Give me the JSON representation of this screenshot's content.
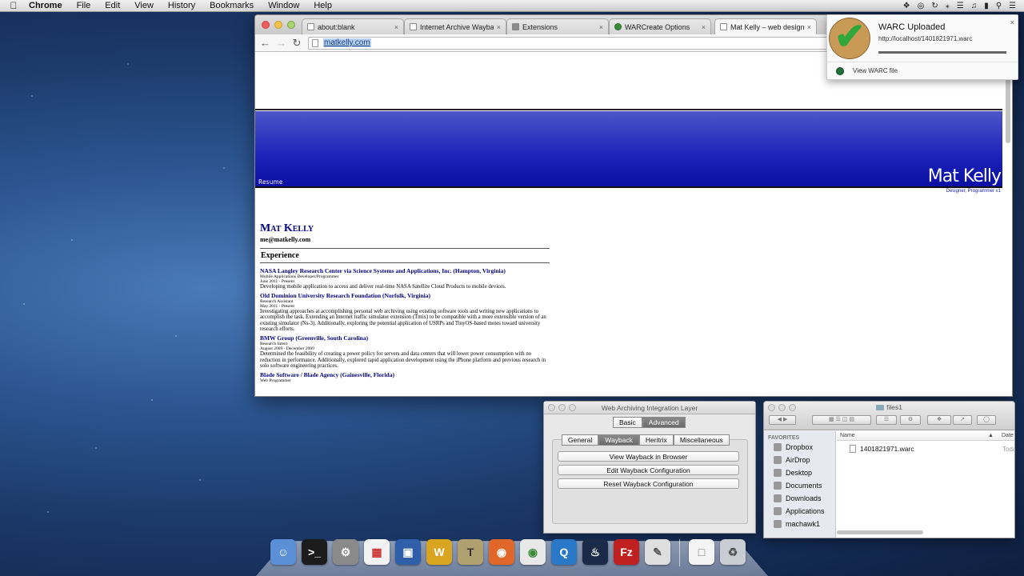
{
  "menubar": {
    "app": "Chrome",
    "items": [
      "File",
      "Edit",
      "View",
      "History",
      "Bookmarks",
      "Window",
      "Help"
    ],
    "status_icons": [
      "apple-icon",
      "dropbox-icon",
      "vpn-icon",
      "sync-icon",
      "bluetooth-icon",
      "wifi-icon",
      "volume-icon",
      "battery-icon",
      "search-icon",
      "list-icon"
    ]
  },
  "browser": {
    "tabs": [
      {
        "label": "about:blank",
        "icon": "page-icon",
        "close": "×"
      },
      {
        "label": "Internet Archive Wayback M",
        "icon": "page-icon",
        "close": "×"
      },
      {
        "label": "Extensions",
        "icon": "puzzle-icon",
        "close": "×"
      },
      {
        "label": "WARCreate Options",
        "icon": "warcreate-icon",
        "close": "×"
      },
      {
        "label": "Mat Kelly – web designer, ",
        "icon": "page-icon",
        "close": "×",
        "active": true
      }
    ],
    "url": "matkelly.com"
  },
  "site": {
    "nav_resume": "Resume",
    "brand": "Mat Kelly",
    "tagline": "Designer, Programmer      v1",
    "name": "Mat Kelly",
    "email": "me@matkelly.com",
    "section": "Experience",
    "jobs": [
      {
        "org": "NASA Langley Research Center via Science Systems and Applications, Inc. (Hampton, Virginia)",
        "role": "Mobile Applications Developer/Programmer",
        "dates": "June 2011 - Present",
        "desc": "Developing mobile application to access and deliver real-time NASA Satellite Cloud Products to mobile devices."
      },
      {
        "org": "Old Dominion University Research Foundation (Norfolk, Virginia)",
        "role": "Research Assistant",
        "dates": "May 2011 - Present",
        "desc": "Investigating approaches at accomplishing personal web archiving using existing software tools and writing new applications to accomplish the task. Extending an Internet traffic simulator extension (Tmix) to be compatible with a more extensible version of an existing simulator (Ns-3). Additionally, exploring the potential application of USRPs and TinyOS-based motes toward university research efforts."
      },
      {
        "org": "BMW Group (Greenville, South Carolina)",
        "role": "Research Intern",
        "dates": "August 2009 - December 2009",
        "desc": "Determined the feasibility of creating a power policy for servers and data centers that will lower power consumption with no reduction in performance. Additionally, explored rapid application development using the iPhone platform and previous research in solo software engineering practices."
      },
      {
        "org": "Blade Software / Blade Agency (Gainesville, Florida)",
        "role": "Web Programmer",
        "dates": "",
        "desc": ""
      }
    ]
  },
  "notification": {
    "title": "WARC Uploaded",
    "subtitle": "http://localhost/1401821971.warc",
    "progress": 1.0,
    "close": "×",
    "action": "View WARC file"
  },
  "wail": {
    "title": "Web Archiving Integration Layer",
    "modes": [
      "Basic",
      "Advanced"
    ],
    "active_mode": "Advanced",
    "tabs": [
      "General",
      "Wayback",
      "Heritrix",
      "Miscellaneous"
    ],
    "active_tab": "Wayback",
    "buttons": [
      "View Wayback in Browser",
      "Edit Wayback Configuration",
      "Reset Wayback Configuration"
    ]
  },
  "finder": {
    "title": "files1",
    "favorites_header": "FAVORITES",
    "favorites": [
      "Dropbox",
      "AirDrop",
      "Desktop",
      "Documents",
      "Downloads",
      "Applications",
      "machawk1"
    ],
    "columns": {
      "name": "Name",
      "date": "Date"
    },
    "files": [
      {
        "name": "1401821971.warc",
        "date": "Toda"
      }
    ]
  },
  "dock": {
    "apps": [
      "finder-icon",
      "terminal-icon",
      "system-preferences-icon",
      "launchpad-icon",
      "virtualbox-icon",
      "warcreate-icon",
      "latex-icon",
      "firefox-icon",
      "chrome-icon",
      "quicktime-icon",
      "wireshark-icon",
      "filezilla-icon",
      "preview-icon",
      "document-icon",
      "trash-icon"
    ]
  },
  "colors": {
    "banner_blue": "#1c22b8",
    "link_navy": "#000080",
    "check_green": "#2ea83b"
  }
}
